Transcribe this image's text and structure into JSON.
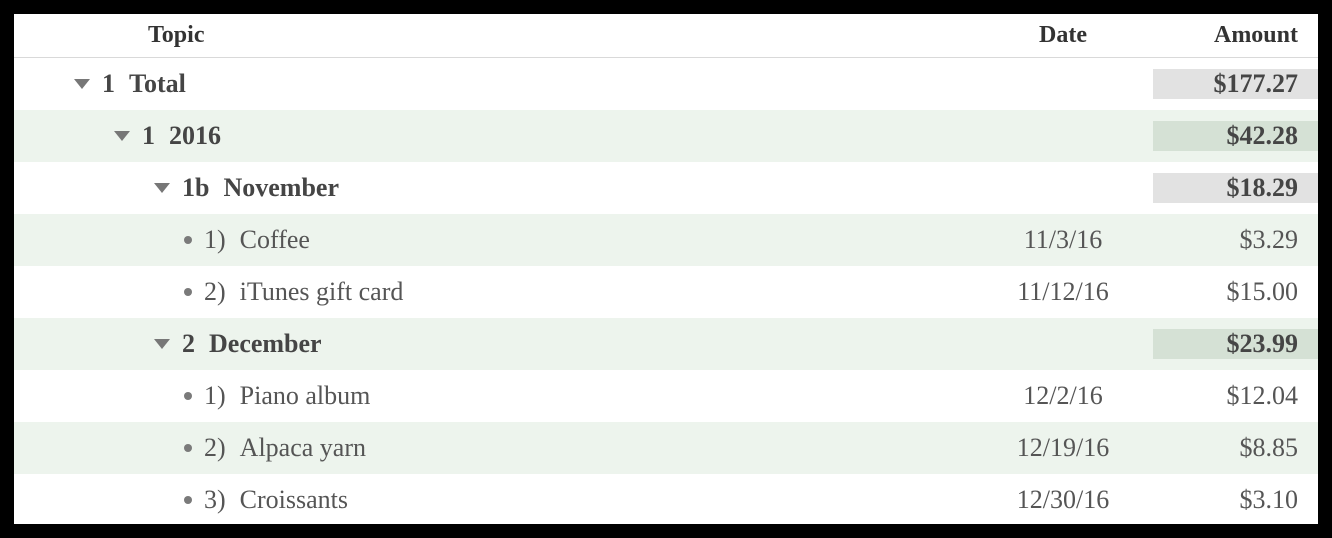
{
  "header": {
    "topic": "Topic",
    "date": "Date",
    "amount": "Amount"
  },
  "rows": {
    "total": {
      "num": "1",
      "label": "Total",
      "date": "",
      "amount": "$177.27"
    },
    "y2016": {
      "num": "1",
      "label": "2016",
      "date": "",
      "amount": "$42.28"
    },
    "nov": {
      "num": "1b",
      "label": "November",
      "date": "",
      "amount": "$18.29"
    },
    "nov1": {
      "num": "1)",
      "label": "Coffee",
      "date": "11/3/16",
      "amount": "$3.29"
    },
    "nov2": {
      "num": "2)",
      "label": "iTunes gift card",
      "date": "11/12/16",
      "amount": "$15.00"
    },
    "dec": {
      "num": "2",
      "label": "December",
      "date": "",
      "amount": "$23.99"
    },
    "dec1": {
      "num": "1)",
      "label": "Piano album",
      "date": "12/2/16",
      "amount": "$12.04"
    },
    "dec2": {
      "num": "2)",
      "label": "Alpaca yarn",
      "date": "12/19/16",
      "amount": "$8.85"
    },
    "dec3": {
      "num": "3)",
      "label": "Croissants",
      "date": "12/30/16",
      "amount": "$3.10"
    }
  }
}
